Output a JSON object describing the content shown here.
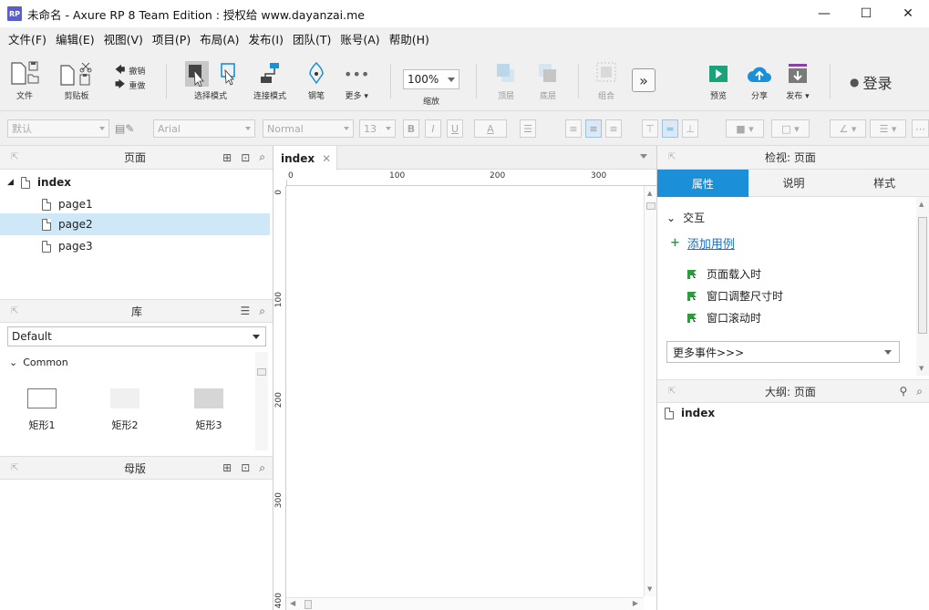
{
  "window": {
    "title": "未命名 - Axure RP 8 Team Edition : 授权给 www.dayanzai.me",
    "logo_text": "RP",
    "min": "—",
    "max": "☐",
    "close": "✕"
  },
  "menu": [
    "文件(F)",
    "编辑(E)",
    "视图(V)",
    "项目(P)",
    "布局(A)",
    "发布(I)",
    "团队(T)",
    "账号(A)",
    "帮助(H)"
  ],
  "toolbar": {
    "file": "文件",
    "clipboard": "剪贴板",
    "undo": "撤销",
    "redo": "重做",
    "select_mode": "选择模式",
    "connect_mode": "连接模式",
    "pen": "钢笔",
    "more": "更多 ▾",
    "zoom_value": "100%",
    "zoom_label": "缩放",
    "top": "顶层",
    "bottom": "底层",
    "group": "组合",
    "preview": "预览",
    "share": "分享",
    "publish": "发布 ▾",
    "login": "登录",
    "more_btn": "»"
  },
  "formatbar": {
    "style": "默认",
    "font": "Arial",
    "weight": "Normal",
    "size": "13",
    "bold": "B",
    "italic": "I",
    "underline": "U",
    "fontcolor": "A"
  },
  "pages_panel": {
    "title": "页面",
    "root": "index",
    "pages": [
      "page1",
      "page2",
      "page3"
    ],
    "selected": "page2"
  },
  "library_panel": {
    "title": "库",
    "selected_library": "Default",
    "group": "Common",
    "widgets": [
      "矩形1",
      "矩形2",
      "矩形3"
    ]
  },
  "masters_panel": {
    "title": "母版"
  },
  "canvas": {
    "tab": "index",
    "ruler_top": [
      "0",
      "100",
      "200",
      "300"
    ],
    "ruler_left": [
      "0",
      "100",
      "200",
      "300"
    ]
  },
  "inspector": {
    "title": "检视: 页面",
    "tabs": [
      "属性",
      "说明",
      "样式"
    ],
    "active_tab": "属性",
    "section": "交互",
    "add_case": "添加用例",
    "events": [
      "页面载入时",
      "窗口调整尺寸时",
      "窗口滚动时"
    ],
    "more_events": "更多事件>>>"
  },
  "outline": {
    "title": "大纲: 页面",
    "root": "index"
  },
  "colors": {
    "accent": "#1b8fd8",
    "selected_row": "#cfe8f7",
    "preview_green": "#1aa37a",
    "share_blue": "#1b8fd8",
    "publish_purple": "#8b3fa8",
    "event_green": "#2e9b3f"
  }
}
